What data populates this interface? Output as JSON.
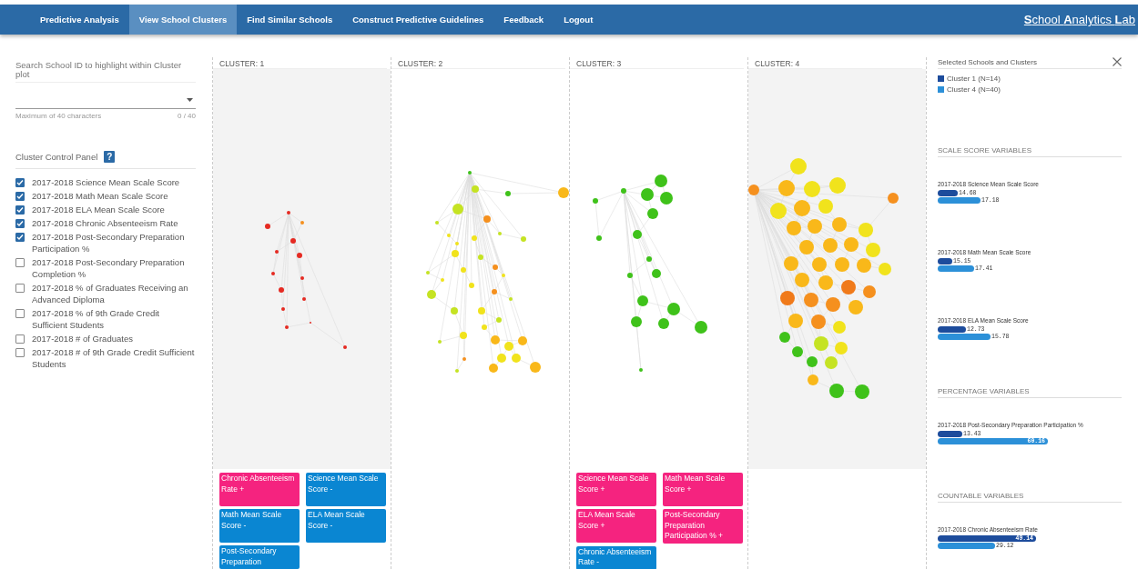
{
  "nav": {
    "items": [
      {
        "label": "Predictive Analysis",
        "selected": false
      },
      {
        "label": "View School Clusters",
        "selected": true
      },
      {
        "label": "Find Similar Schools",
        "selected": false
      },
      {
        "label": "Construct Predictive Guidelines",
        "selected": false
      },
      {
        "label": "Feedback",
        "selected": false
      },
      {
        "label": "Logout",
        "selected": false
      }
    ],
    "logo": "**S**chool **A**nalytics **L**ab"
  },
  "search": {
    "label": "Search School ID to highlight within Cluster plot",
    "hint": "Maximum of 40 characters",
    "counter": "0 / 40"
  },
  "control_panel": {
    "title": "Cluster Control Panel",
    "help": "?",
    "variables": [
      {
        "label": "2017-2018 Science Mean Scale Score",
        "checked": true
      },
      {
        "label": "2017-2018 Math Mean Scale Score",
        "checked": true
      },
      {
        "label": "2017-2018 ELA Mean Scale Score",
        "checked": true
      },
      {
        "label": "2017-2018 Chronic Absenteeism Rate",
        "checked": true
      },
      {
        "label": "2017-2018 Post-Secondary Preparation Participation %",
        "checked": true
      },
      {
        "label": "2017-2018 Post-Secondary Preparation Completion %",
        "checked": false
      },
      {
        "label": "2017-2018 % of Graduates Receiving an Advanced Diploma",
        "checked": false
      },
      {
        "label": "2017-2018 % of 9th Grade Credit Sufficient Students",
        "checked": false
      },
      {
        "label": "2017-2018 # of Graduates",
        "checked": false
      },
      {
        "label": "2017-2018 # of 9th Grade Credit Sufficient Students",
        "checked": false
      }
    ]
  },
  "clusters": [
    {
      "title": "CLUSTER: 1",
      "selected": true,
      "tags": [
        {
          "label": "Chronic Absenteeism Rate +",
          "color": "#f5237f"
        },
        {
          "label": "Science Mean Scale Score -",
          "color": "#0a86d2"
        },
        {
          "label": "Math Mean Scale Score -",
          "color": "#0a86d2"
        },
        {
          "label": "ELA Mean Scale Score -",
          "color": "#0a86d2"
        },
        {
          "label": "Post-Secondary Preparation",
          "color": "#0a86d2"
        }
      ]
    },
    {
      "title": "CLUSTER: 2",
      "selected": false
    },
    {
      "title": "CLUSTER: 3",
      "selected": false,
      "tags": [
        {
          "label": "Science Mean Scale Score +",
          "color": "#f5237f"
        },
        {
          "label": "Math Mean Scale Score +",
          "color": "#f5237f"
        },
        {
          "label": "ELA Mean Scale Score +",
          "color": "#f5237f"
        },
        {
          "label": "Post-Secondary Preparation Participation % +",
          "color": "#f5237f"
        },
        {
          "label": "Chronic Absenteeism Rate -",
          "color": "#0a86d2"
        }
      ]
    },
    {
      "title": "CLUSTER: 4",
      "selected": true
    }
  ],
  "details": {
    "title": "Selected Schools and Clusters",
    "legend": [
      {
        "label": "Cluster 1 (N=14)",
        "color": "#1d4c9c"
      },
      {
        "label": "Cluster 4 (N=40)",
        "color": "#2c90d8"
      }
    ],
    "sections": [
      {
        "heading": "SCALE SCORE VARIABLES",
        "variables": [
          {
            "title": "2017-2018 Science Mean Scale Score",
            "bars": [
              {
                "color": "#1d4c9c",
                "reading": "14.68"
              },
              {
                "color": "#2c90d8",
                "reading": "17.18"
              }
            ]
          },
          {
            "title": "2017-2018 Math Mean Scale Score",
            "bars": [
              {
                "color": "#1d4c9c",
                "reading": "15.15"
              },
              {
                "color": "#2c90d8",
                "reading": "17.41"
              }
            ]
          },
          {
            "title": "2017-2018 ELA Mean Scale Score",
            "bars": [
              {
                "color": "#1d4c9c",
                "reading": "12.73"
              },
              {
                "color": "#2c90d8",
                "reading": "15.78"
              }
            ]
          }
        ]
      },
      {
        "heading": "PERCENTAGE VARIABLES",
        "variables": [
          {
            "title": "2017-2018 Post-Secondary Preparation Participation %",
            "bars": [
              {
                "color": "#1d4c9c",
                "reading": "13.43"
              },
              {
                "color": "#2c90d8",
                "reading": "60.16"
              }
            ]
          }
        ]
      },
      {
        "heading": "COUNTABLE VARIABLES",
        "variables": [
          {
            "title": "2017-2018 Chronic Absenteeism Rate",
            "bars": [
              {
                "color": "#1d4c9c",
                "reading": "49.14"
              },
              {
                "color": "#2c90d8",
                "reading": "29.12"
              }
            ]
          }
        ]
      }
    ]
  }
}
